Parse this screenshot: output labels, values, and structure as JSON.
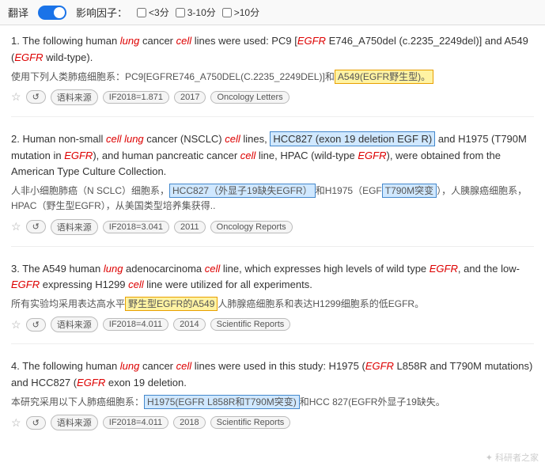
{
  "toolbar": {
    "translate_label": "翻译",
    "toggle_state": "on",
    "impact_factor_label": "影响因子：",
    "filters": [
      {
        "label": "<3分",
        "checked": false
      },
      {
        "label": "3-10分",
        "checked": false
      },
      {
        "label": ">10分",
        "checked": false
      }
    ]
  },
  "results": [
    {
      "num": "1.",
      "en_parts": [
        {
          "text": "The following human "
        },
        {
          "text": "lung",
          "italic": true
        },
        {
          "text": " cancer "
        },
        {
          "text": "cell",
          "italic": true
        },
        {
          "text": " lines were used: PC9 ["
        },
        {
          "text": "EGFR",
          "italic": true,
          "red": true
        },
        {
          "text": " E746_A750del (c.2235_2249del)] and A549 ("
        },
        {
          "text": "EGFR",
          "italic": true,
          "red": true
        },
        {
          "text": " wild-type)."
        }
      ],
      "zh_parts": [
        {
          "text": "使用下列人类肺癌细胞系：PC9[EGFRE746_A750DEL(C.2235_2249DEL)]和"
        },
        {
          "text": "A549(EGFR野生型)。",
          "highlight": "yellow"
        }
      ],
      "source_label": "语料来源",
      "if_label": "IF2018=1.871",
      "year": "2017",
      "journal": "Oncology Letters"
    },
    {
      "num": "2.",
      "en_parts": [
        {
          "text": "Human non-small "
        },
        {
          "text": "cell lung",
          "italic": true
        },
        {
          "text": " cancer (NSCLC) "
        },
        {
          "text": "cell",
          "italic": true
        },
        {
          "text": " lines, "
        },
        {
          "text": "HCC827 (exon 19 deletion EGF R)",
          "highlight": "blue"
        },
        {
          "text": " and H1975 (T790M mutation in "
        },
        {
          "text": "EGFR",
          "italic": true,
          "red": true
        },
        {
          "text": "), and human pancreatic cancer "
        },
        {
          "text": "cell",
          "italic": true
        },
        {
          "text": " line, HPAC (wild-type "
        },
        {
          "text": "EGFR",
          "italic": true,
          "red": true
        },
        {
          "text": "), were obtained from the American Type Culture Collection."
        }
      ],
      "zh_parts": [
        {
          "text": "人非小细胞肺癌（N SCLC）细胞系，"
        },
        {
          "text": "HCC827（外显子19缺失EGFR）",
          "highlight": "blue"
        },
        {
          "text": "和H1975（EGF"
        },
        {
          "text": "T790M突变",
          "highlight": "blue"
        },
        {
          "text": "），人胰腺癌细胞系，HPAC（野生型EGFR），从美国类型培养集获得.."
        }
      ],
      "source_label": "语料来源",
      "if_label": "IF2018=3.041",
      "year": "2011",
      "journal": "Oncology Reports"
    },
    {
      "num": "3.",
      "en_parts": [
        {
          "text": "The A549 human "
        },
        {
          "text": "lung",
          "italic": true
        },
        {
          "text": " adenocarcinoma "
        },
        {
          "text": "cell",
          "italic": true
        },
        {
          "text": " line, which expresses high levels of wild type "
        },
        {
          "text": "EGFR",
          "italic": true,
          "red": true
        },
        {
          "text": ", and the low-"
        },
        {
          "text": "EGFR",
          "italic": true,
          "red": true
        },
        {
          "text": " expressing H1299 "
        },
        {
          "text": "cell",
          "italic": true
        },
        {
          "text": " line were utilized for all experiments."
        }
      ],
      "zh_parts": [
        {
          "text": "所有实验均采用表达高水平"
        },
        {
          "text": "野生型EGFR的A549",
          "highlight": "yellow"
        },
        {
          "text": "人肺腺癌细胞系和表达H1299细胞系的低EGFR。"
        }
      ],
      "source_label": "语料来源",
      "if_label": "IF2018=4.011",
      "year": "2014",
      "journal": "Scientific Reports"
    },
    {
      "num": "4.",
      "en_parts": [
        {
          "text": "The following human "
        },
        {
          "text": "lung",
          "italic": true
        },
        {
          "text": " cancer "
        },
        {
          "text": "cell",
          "italic": true
        },
        {
          "text": " lines were used in this study: H1975 ("
        },
        {
          "text": "EGFR",
          "italic": true,
          "red": true
        },
        {
          "text": " L858R and T790M mutations) and HCC827 ("
        },
        {
          "text": "EGFR",
          "italic": true,
          "red": true
        },
        {
          "text": " exon 19 deletion."
        }
      ],
      "zh_parts": [
        {
          "text": "本研究采用以下人肺癌细胞系："
        },
        {
          "text": "H1975(EGFR L858R和T790M突变)",
          "highlight": "blue"
        },
        {
          "text": "和HCC 827(EGFR外显子19缺失。"
        }
      ],
      "source_label": "语料来源",
      "if_label": "IF2018=4.011",
      "year": "2018",
      "journal": "Scientific Reports"
    }
  ],
  "watermark": "科研者之家"
}
